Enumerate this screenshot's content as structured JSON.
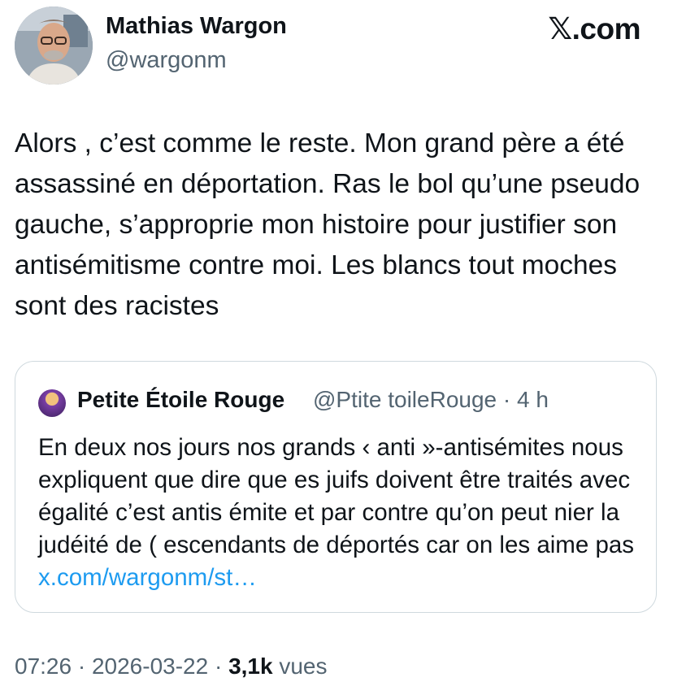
{
  "author": {
    "name": "Mathias Wargon",
    "handle": "@wargonm"
  },
  "brand": {
    "mark": "𝕏",
    "suffix": ".com"
  },
  "tweet": {
    "text": "Alors , c’est comme le reste. Mon grand père a été assassiné en déportation. Ras le bol qu’une pseudo gauche, s’approprie mon histoire pour justifier son antisémitisme contre moi. Les blancs tout moches sont des racistes"
  },
  "quote": {
    "name": "Petite Étoile Rouge",
    "handle_time": "@Ptite toileRouge · 4 h",
    "text": "En deux nos jours nos grands ‹ anti »-antisémites nous expliquent que dire que es juifs doivent être traités avec égalité c’est antis émite et par contre qu’on peut nier la judéité de ( escendants de déportés car on les aime pas ",
    "link": "x.com/wargonm/st…"
  },
  "meta": {
    "time": "07:26 · 2026-03-22 · ",
    "views_count": "3,1k",
    "views_label": " vues"
  },
  "colors": {
    "text": "#0f1419",
    "secondary": "#536471",
    "link": "#1d9bf0",
    "border": "#cfd9de"
  }
}
